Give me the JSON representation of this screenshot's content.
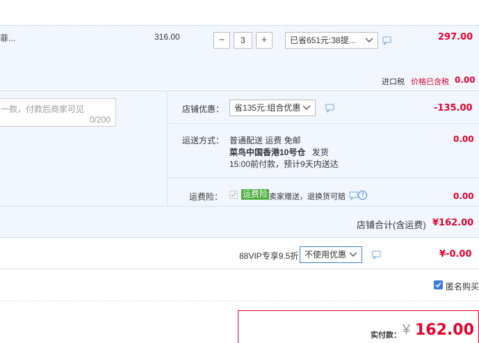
{
  "item": {
    "name_fragment": "菲...",
    "unit_price": "316.00",
    "quantity": "3",
    "minus": "−",
    "plus": "+",
    "promo_select": "已省651元:38提...",
    "subtotal": "297.00",
    "tax_label": "进口税",
    "tax_note": "价格已含税",
    "tax_value": "0.00"
  },
  "message": {
    "placeholder": "一款，付款后商家可见",
    "counter": "0/200"
  },
  "shop_discount": {
    "label": "店铺优惠：",
    "select": "省135元:组合优惠",
    "value": "-135.00"
  },
  "shipping": {
    "label": "运送方式：",
    "line1": "普通配送 运费 免邮",
    "line2_bold": "菜鸟中国香港10号仓",
    "line2_rest": "发货",
    "line3": "15:00前付款，预计9天内送达",
    "value": "0.00"
  },
  "insurance": {
    "label": "运费险：",
    "badge": "运费险",
    "text": "卖家赠送，退换货可赔",
    "help": "?",
    "value": "0.00"
  },
  "shop_total": {
    "label": "店铺合计(含运费)",
    "value": "¥162.00"
  },
  "vip": {
    "label": "88VIP专享9.5折",
    "select": "不使用优惠",
    "value": "¥-0.00"
  },
  "anonymous": {
    "label": "匿名购买"
  },
  "pay": {
    "label": "实付款：",
    "currency": "¥",
    "amount": "162.00"
  },
  "colors": {
    "accent_red": "#e4002b",
    "band_blue": "#f2f7ff",
    "border_blue": "#b4d0ee",
    "insurance_green": "#4aaa3a",
    "checkbox_blue": "#3a7bd5"
  }
}
